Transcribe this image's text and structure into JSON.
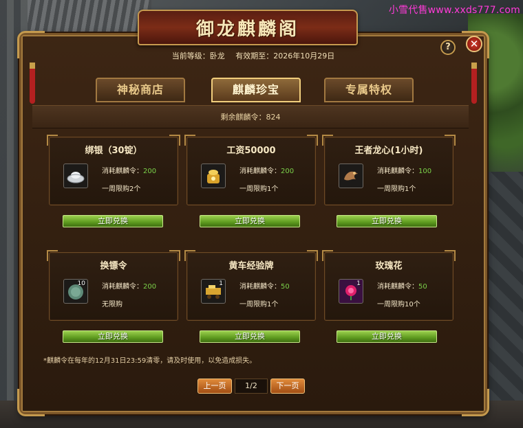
{
  "watermark": "小雪代售www.xxds777.com",
  "title": "御龙麒麟阁",
  "help_label": "?",
  "close_label": "✕",
  "header": {
    "level_label": "当前等级：卧龙",
    "expiry_label": "有效期至：2026年10月29日"
  },
  "tabs": [
    {
      "label": "神秘商店",
      "active": false
    },
    {
      "label": "麒麟珍宝",
      "active": true
    },
    {
      "label": "专属特权",
      "active": false
    }
  ],
  "tokens_label": "剩余麒麟令：824",
  "cost_prefix": "消耗麒麟令：",
  "items": [
    {
      "name": "绑银（30锭）",
      "cost": "200",
      "limit": "一周限购2个",
      "icon": "silver-ingot-icon",
      "count": ""
    },
    {
      "name": "工资50000",
      "cost": "200",
      "limit": "一周限购1个",
      "icon": "gold-bag-icon",
      "count": ""
    },
    {
      "name": "王者龙心(1小时)",
      "cost": "100",
      "limit": "一周限购1个",
      "icon": "dragon-heart-icon",
      "count": ""
    },
    {
      "name": "换镖令",
      "cost": "200",
      "limit": "无限购",
      "icon": "escort-token-icon",
      "count": "10"
    },
    {
      "name": "黄车经验牌",
      "cost": "50",
      "limit": "一周限购1个",
      "icon": "cart-exp-card-icon",
      "count": "1"
    },
    {
      "name": "玫瑰花",
      "cost": "50",
      "limit": "一周限购10个",
      "icon": "rose-icon",
      "count": "1"
    }
  ],
  "redeem_label": "立即兑换",
  "footnote": "*麒麟令在每年的12月31日23:59清零，请及时使用，以免造成损失。",
  "pager": {
    "prev_label": "上一页",
    "page_label": "1/2",
    "next_label": "下一页"
  },
  "colors": {
    "frame": "#2a1a0d",
    "gold_border": "#c49a4e",
    "cost_number": "#7bd24a",
    "redeem_button": "#5d9a1f",
    "page_button": "#d2772c"
  }
}
